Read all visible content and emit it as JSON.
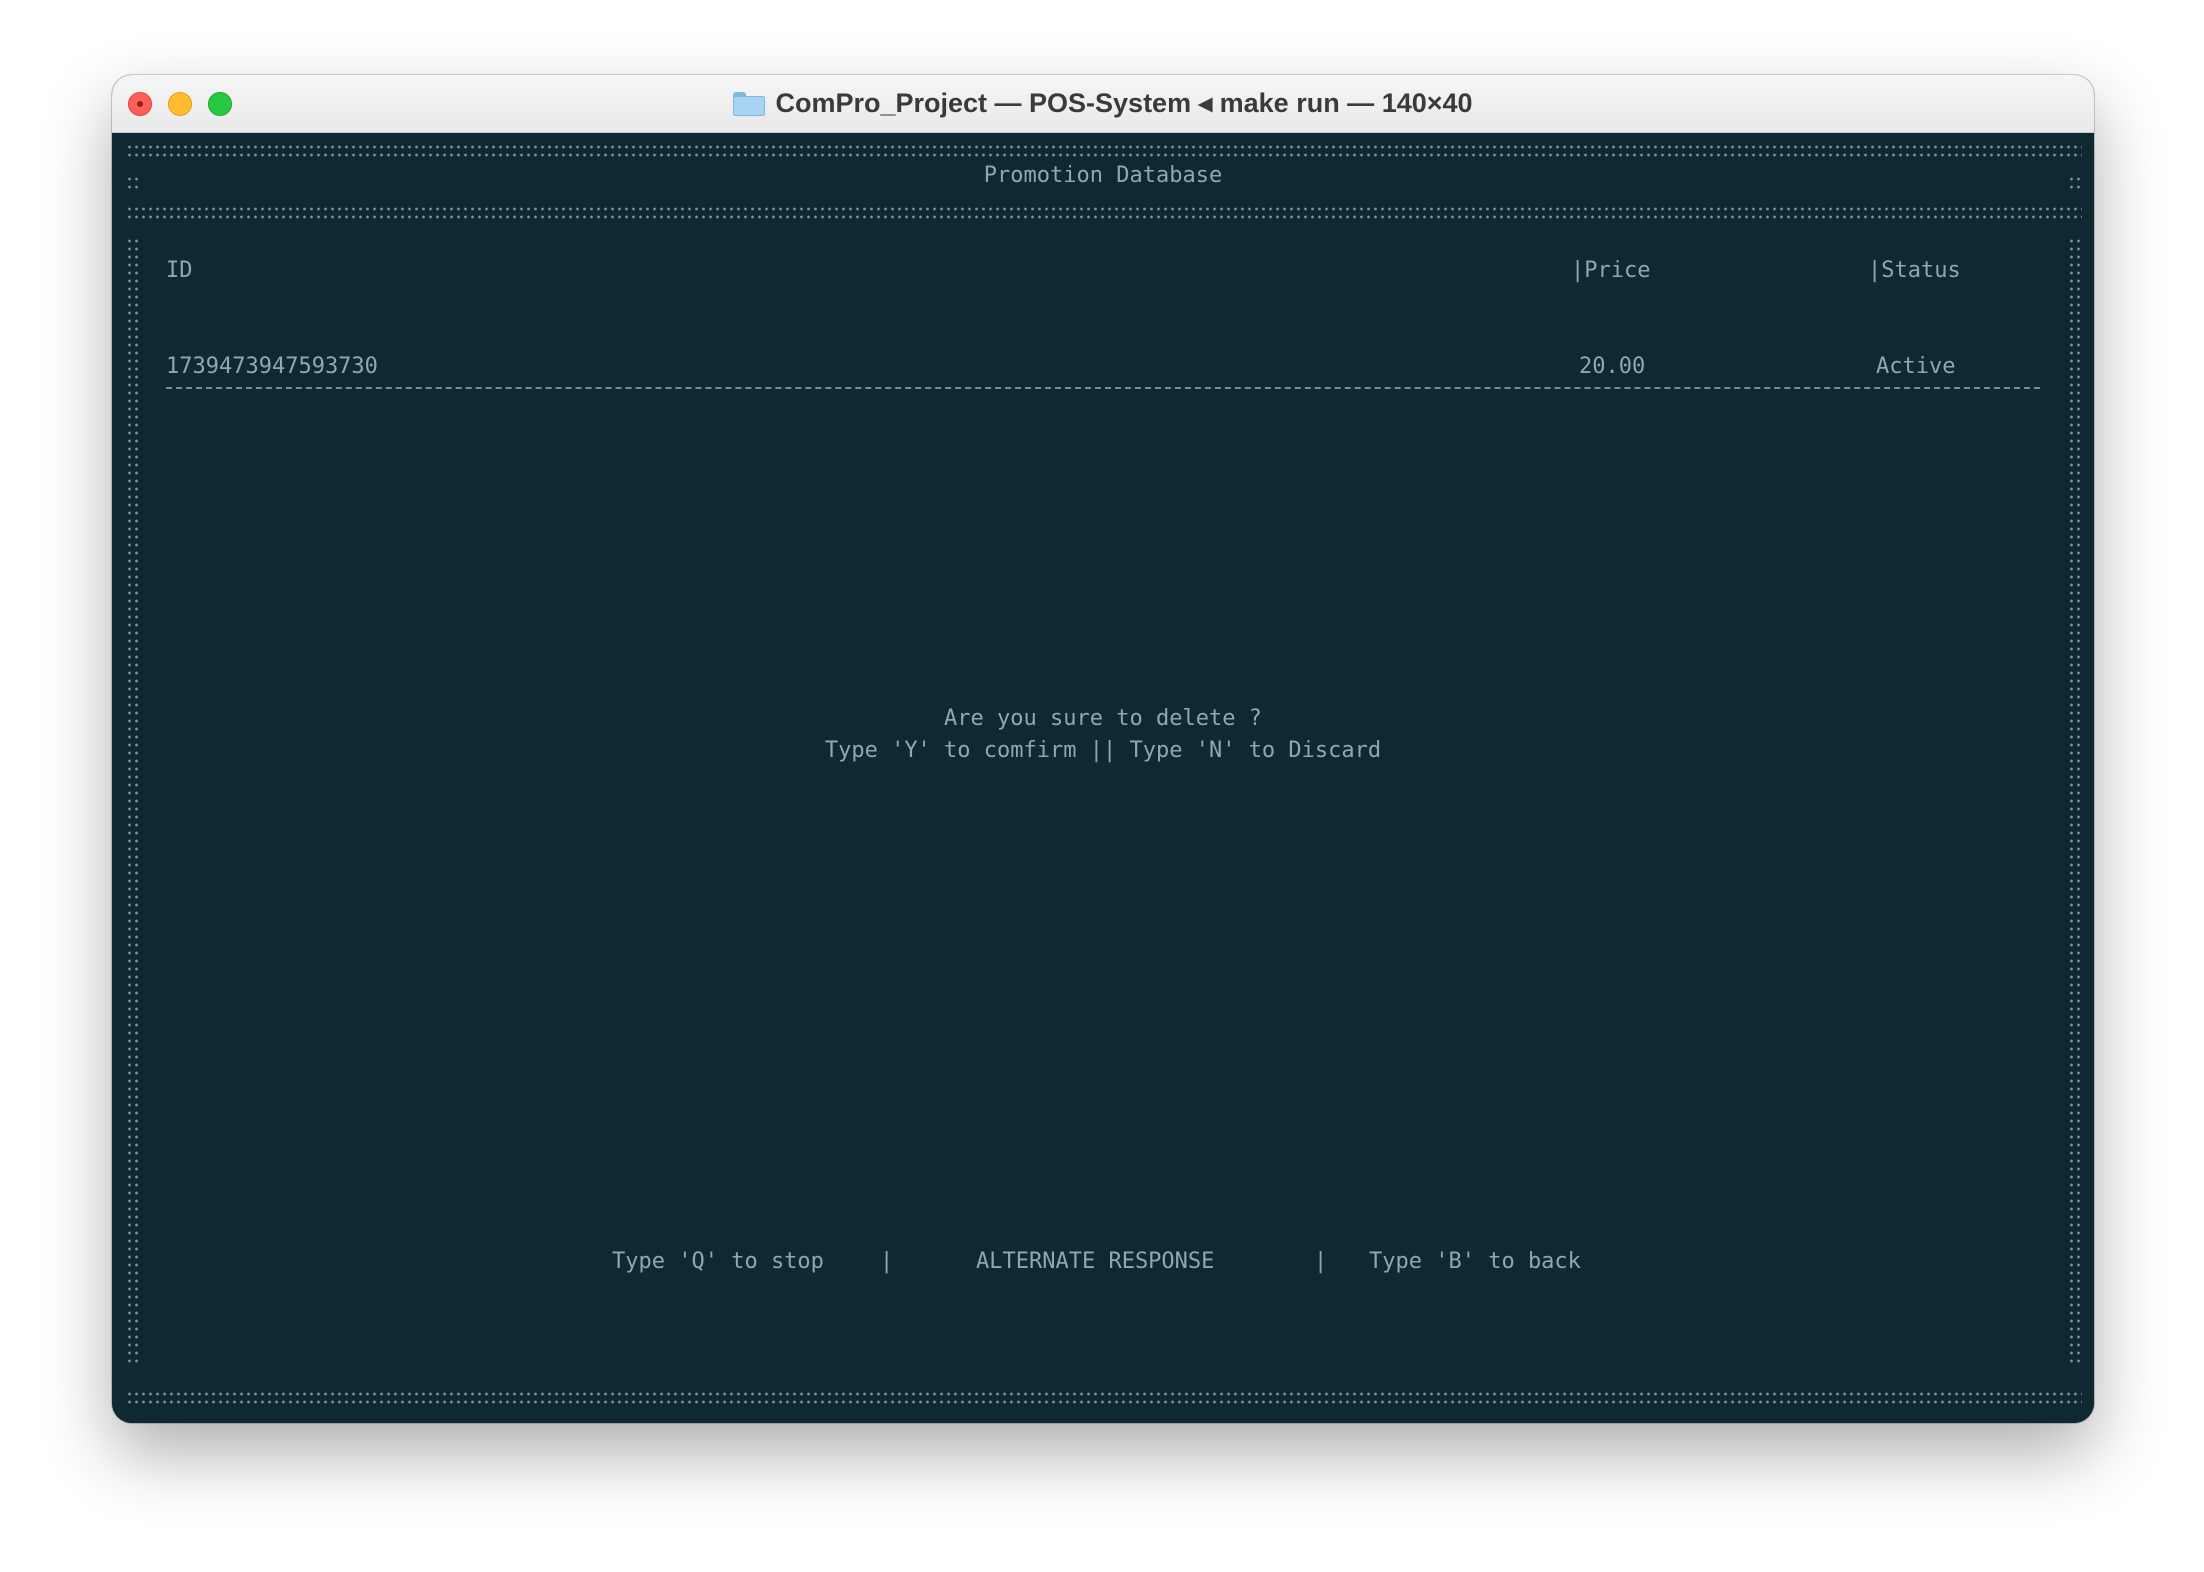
{
  "window": {
    "title": "ComPro_Project — POS-System ◂ make run — 140×40"
  },
  "screen": {
    "heading": "Promotion Database",
    "table": {
      "columns": [
        "ID",
        "|Price",
        "|Status"
      ],
      "rows": [
        {
          "id": "1739473947593730",
          "price": "20.00",
          "status": "Active"
        }
      ]
    },
    "dialog": {
      "question": "Are you sure to delete ?",
      "instructions": "Type 'Y' to comfirm || Type 'N' to Discard"
    },
    "footer": {
      "stop": "Type 'Q' to stop",
      "separator": "|",
      "alternate": "ALTERNATE RESPONSE",
      "back": "Type 'B' to back"
    },
    "prompt": ">>>"
  }
}
